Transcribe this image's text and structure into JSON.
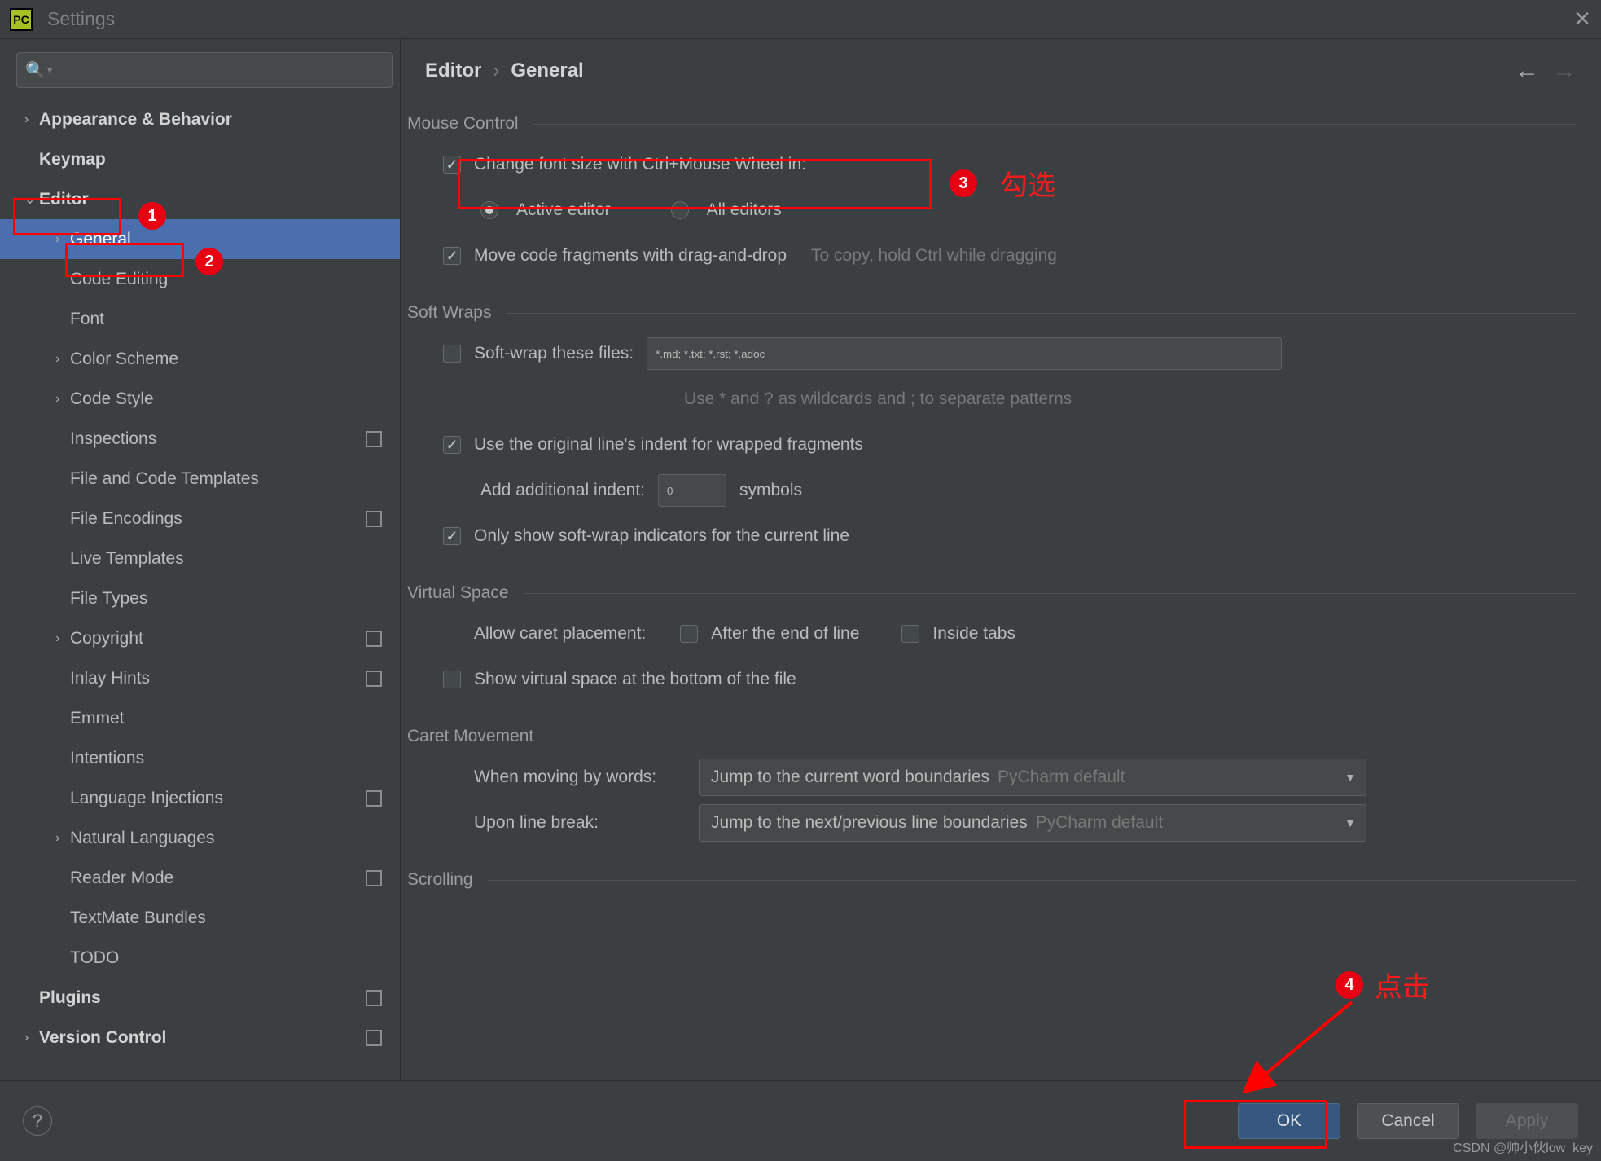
{
  "window": {
    "title": "Settings",
    "app_abbrev": "PC"
  },
  "sidebar": {
    "search_placeholder": "",
    "items": [
      {
        "label": "Appearance & Behavior",
        "depth": 0,
        "bold": true,
        "chev": "›",
        "proj": false
      },
      {
        "label": "Keymap",
        "depth": 0,
        "bold": true,
        "chev": "",
        "proj": false
      },
      {
        "label": "Editor",
        "depth": 0,
        "bold": true,
        "chev": "⌄",
        "proj": false
      },
      {
        "label": "General",
        "depth": 1,
        "bold": false,
        "chev": "›",
        "proj": false,
        "selected": true
      },
      {
        "label": "Code Editing",
        "depth": 1,
        "bold": false,
        "chev": "",
        "proj": false
      },
      {
        "label": "Font",
        "depth": 1,
        "bold": false,
        "chev": "",
        "proj": false
      },
      {
        "label": "Color Scheme",
        "depth": 1,
        "bold": false,
        "chev": "›",
        "proj": false
      },
      {
        "label": "Code Style",
        "depth": 1,
        "bold": false,
        "chev": "›",
        "proj": false
      },
      {
        "label": "Inspections",
        "depth": 1,
        "bold": false,
        "chev": "",
        "proj": true
      },
      {
        "label": "File and Code Templates",
        "depth": 1,
        "bold": false,
        "chev": "",
        "proj": false
      },
      {
        "label": "File Encodings",
        "depth": 1,
        "bold": false,
        "chev": "",
        "proj": true
      },
      {
        "label": "Live Templates",
        "depth": 1,
        "bold": false,
        "chev": "",
        "proj": false
      },
      {
        "label": "File Types",
        "depth": 1,
        "bold": false,
        "chev": "",
        "proj": false
      },
      {
        "label": "Copyright",
        "depth": 1,
        "bold": false,
        "chev": "›",
        "proj": true
      },
      {
        "label": "Inlay Hints",
        "depth": 1,
        "bold": false,
        "chev": "",
        "proj": true
      },
      {
        "label": "Emmet",
        "depth": 1,
        "bold": false,
        "chev": "",
        "proj": false
      },
      {
        "label": "Intentions",
        "depth": 1,
        "bold": false,
        "chev": "",
        "proj": false
      },
      {
        "label": "Language Injections",
        "depth": 1,
        "bold": false,
        "chev": "",
        "proj": true
      },
      {
        "label": "Natural Languages",
        "depth": 1,
        "bold": false,
        "chev": "›",
        "proj": false
      },
      {
        "label": "Reader Mode",
        "depth": 1,
        "bold": false,
        "chev": "",
        "proj": true
      },
      {
        "label": "TextMate Bundles",
        "depth": 1,
        "bold": false,
        "chev": "",
        "proj": false
      },
      {
        "label": "TODO",
        "depth": 1,
        "bold": false,
        "chev": "",
        "proj": false
      },
      {
        "label": "Plugins",
        "depth": 0,
        "bold": true,
        "chev": "",
        "proj": true
      },
      {
        "label": "Version Control",
        "depth": 0,
        "bold": true,
        "chev": "›",
        "proj": true
      }
    ]
  },
  "breadcrumb": {
    "root": "Editor",
    "sep": "›",
    "leaf": "General"
  },
  "sections": {
    "mouse": {
      "title": "Mouse Control",
      "change_font": {
        "label": "Change font size with Ctrl+Mouse Wheel in:",
        "checked": true
      },
      "radio_active": "Active editor",
      "radio_all": "All editors",
      "move_drag": {
        "label": "Move code fragments with drag-and-drop",
        "checked": true,
        "hint": "To copy, hold Ctrl while dragging"
      }
    },
    "soft": {
      "title": "Soft Wraps",
      "wrap_files": {
        "label": "Soft-wrap these files:",
        "checked": false,
        "value": "*.md; *.txt; *.rst; *.adoc",
        "hint": "Use * and ? as wildcards and ; to separate patterns"
      },
      "orig_indent": {
        "label": "Use the original line's indent for wrapped fragments",
        "checked": true
      },
      "add_indent_label": "Add additional indent:",
      "add_indent_value": "0",
      "add_indent_suffix": "symbols",
      "only_current": {
        "label": "Only show soft-wrap indicators for the current line",
        "checked": true
      }
    },
    "virtual": {
      "title": "Virtual Space",
      "allow_caret": "Allow caret placement:",
      "after_eol": {
        "label": "After the end of line",
        "checked": false
      },
      "inside_tabs": {
        "label": "Inside tabs",
        "checked": false
      },
      "show_virtual": {
        "label": "Show virtual space at the bottom of the file",
        "checked": false
      }
    },
    "caret": {
      "title": "Caret Movement",
      "by_words_label": "When moving by words:",
      "by_words_value": "Jump to the current word boundaries",
      "by_words_def": "PyCharm default",
      "line_break_label": "Upon line break:",
      "line_break_value": "Jump to the next/previous line boundaries",
      "line_break_def": "PyCharm default"
    },
    "scrolling": {
      "title": "Scrolling"
    }
  },
  "footer": {
    "ok": "OK",
    "cancel": "Cancel",
    "apply": "Apply"
  },
  "annotations": {
    "check_text": "勾选",
    "click_text": "点击",
    "watermark": "CSDN @帅小伙low_key"
  }
}
